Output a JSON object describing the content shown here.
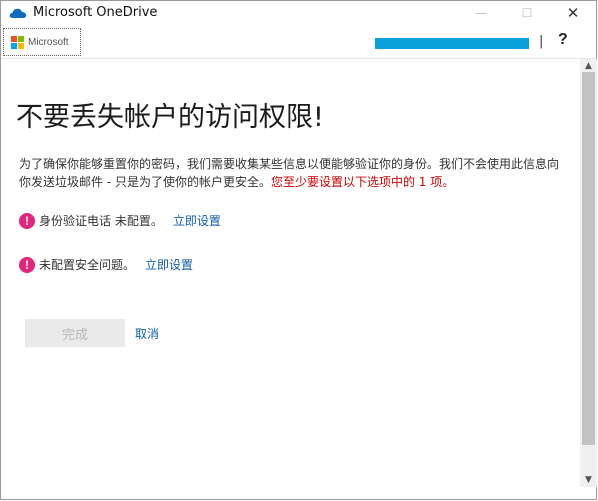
{
  "window": {
    "title": "Microsoft OneDrive",
    "minimize_glyph": "—",
    "maximize_glyph": "☐",
    "close_glyph": "✕",
    "app_icon": "onedrive-cloud-icon"
  },
  "toolbar": {
    "brand_label": "Microsoft",
    "separator": "|",
    "help_label": "?"
  },
  "main": {
    "heading": "不要丢失帐户的访问权限!",
    "description": "为了确保你能够重置你的密码，我们需要收集某些信息以便能够验证你的身份。我们不会使用此信息向你发送垃圾邮件 - 只是为了使你的帐户更安全。",
    "requirement_note": "您至少要设置以下选项中的 1 项。",
    "alerts": [
      {
        "icon": "exclamation-icon",
        "icon_glyph": "!",
        "text": "身份验证电话 未配置。",
        "link": "立即设置"
      },
      {
        "icon": "exclamation-icon",
        "icon_glyph": "!",
        "text": "未配置安全问题。",
        "link": "立即设置"
      }
    ],
    "done_label": "完成",
    "cancel_label": "取消"
  },
  "scrollbar": {
    "up_glyph": "▲",
    "down_glyph": "▼"
  },
  "colors": {
    "accent_link": "#0f5ea8",
    "alert_icon": "#e5247b",
    "warning_text": "#cc0000",
    "account_bar": "#0aa0dc"
  }
}
